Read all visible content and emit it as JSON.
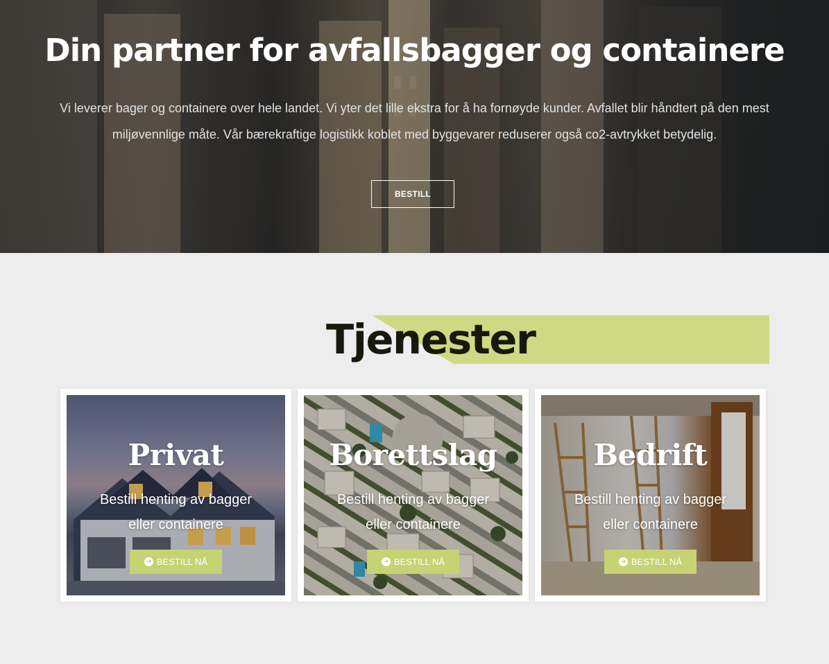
{
  "hero": {
    "title": "Din partner for avfallsbagger og containere",
    "description": "Vi leverer bager og containere over hele landet. Vi yter det lille ekstra for å ha fornøyde kunder. Avfallet blir håndtert på den mest miljøvennlige måte. Vår bærekraftige logistikk koblet med byggevarer reduserer også co2-avtrykket betydelig.",
    "button_label": "BESTILL"
  },
  "services": {
    "title": "Tjenester",
    "accent_color": "#cfd984",
    "cards": [
      {
        "title": "Privat",
        "description": "Bestill henting av bagger eller containere",
        "button_label": "BESTILL NÅ"
      },
      {
        "title": "Borettslag",
        "description": "Bestill henting av bagger eller containere",
        "button_label": "BESTILL NÅ"
      },
      {
        "title": "Bedrift",
        "description": "Bestill henting av bagger eller containere",
        "button_label": "BESTILL NÅ"
      }
    ],
    "button_icon": "arrow-circle-right-icon",
    "button_color": "#c6d373"
  }
}
